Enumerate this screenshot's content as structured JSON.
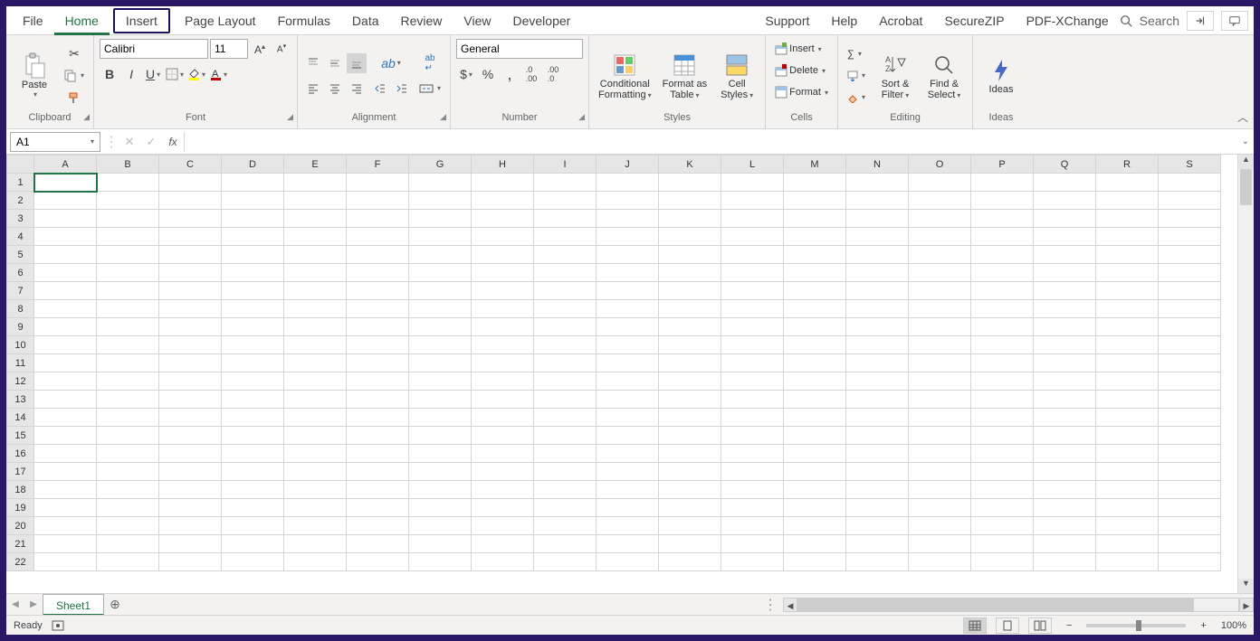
{
  "tabs": {
    "file": "File",
    "home": "Home",
    "insert": "Insert",
    "page_layout": "Page Layout",
    "formulas": "Formulas",
    "data": "Data",
    "review": "Review",
    "view": "View",
    "developer": "Developer",
    "support": "Support",
    "help": "Help",
    "acrobat": "Acrobat",
    "securezip": "SecureZIP",
    "pdfxchange": "PDF-XChange"
  },
  "search_placeholder": "Search",
  "ribbon": {
    "clipboard": {
      "label": "Clipboard",
      "paste": "Paste"
    },
    "font": {
      "label": "Font",
      "name": "Calibri",
      "size": "11"
    },
    "alignment": {
      "label": "Alignment"
    },
    "number": {
      "label": "Number",
      "format": "General"
    },
    "styles": {
      "label": "Styles",
      "conditional_l1": "Conditional",
      "conditional_l2": "Formatting",
      "table_l1": "Format as",
      "table_l2": "Table",
      "cell_l1": "Cell",
      "cell_l2": "Styles"
    },
    "cells": {
      "label": "Cells",
      "insert": "Insert",
      "delete": "Delete",
      "format": "Format"
    },
    "editing": {
      "label": "Editing",
      "sort_l1": "Sort &",
      "sort_l2": "Filter",
      "find_l1": "Find &",
      "find_l2": "Select"
    },
    "ideas": {
      "label": "Ideas",
      "btn": "Ideas"
    }
  },
  "formula_bar": {
    "name_box": "A1",
    "formula": ""
  },
  "grid": {
    "columns": [
      "A",
      "B",
      "C",
      "D",
      "E",
      "F",
      "G",
      "H",
      "I",
      "J",
      "K",
      "L",
      "M",
      "N",
      "O",
      "P",
      "Q",
      "R",
      "S"
    ],
    "rows": [
      1,
      2,
      3,
      4,
      5,
      6,
      7,
      8,
      9,
      10,
      11,
      12,
      13,
      14,
      15,
      16,
      17,
      18,
      19,
      20,
      21,
      22
    ],
    "selected": "A1"
  },
  "sheet_tabs": {
    "active": "Sheet1"
  },
  "status": {
    "ready": "Ready",
    "zoom": "100%"
  }
}
